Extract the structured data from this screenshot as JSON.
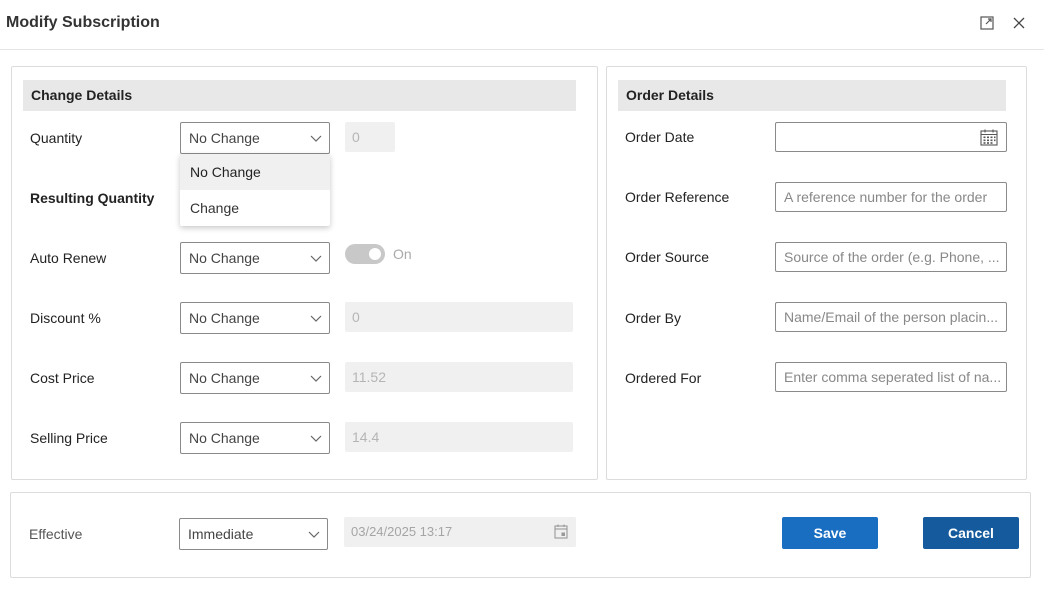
{
  "dialog": {
    "title": "Modify Subscription",
    "expand_icon": "expand-icon",
    "close_icon": "close-icon"
  },
  "change_details": {
    "header": "Change Details",
    "quantity": {
      "label": "Quantity",
      "select": "No Change",
      "value": "0"
    },
    "quantity_dropdown": {
      "options": [
        "No Change",
        "Change"
      ],
      "selected": "No Change"
    },
    "resulting_quantity": {
      "label": "Resulting Quantity"
    },
    "auto_renew": {
      "label": "Auto Renew",
      "select": "No Change",
      "toggle_label": "On",
      "toggle_on": true
    },
    "discount": {
      "label": "Discount %",
      "select": "No Change",
      "value": "0"
    },
    "cost_price": {
      "label": "Cost Price",
      "select": "No Change",
      "value": "11.52"
    },
    "selling_price": {
      "label": "Selling Price",
      "select": "No Change",
      "value": "14.4"
    }
  },
  "order_details": {
    "header": "Order Details",
    "order_date": {
      "label": "Order Date",
      "value": "",
      "icon": "calendar-icon"
    },
    "order_reference": {
      "label": "Order Reference",
      "placeholder": "A reference number for the order"
    },
    "order_source": {
      "label": "Order Source",
      "placeholder": "Source of the order (e.g. Phone, ..."
    },
    "order_by": {
      "label": "Order By",
      "placeholder": "Name/Email of the person placin..."
    },
    "ordered_for": {
      "label": "Ordered For",
      "placeholder": "Enter comma seperated list of na..."
    }
  },
  "footer": {
    "effective_label": "Effective",
    "effective_select": "Immediate",
    "effective_date": "03/24/2025 13:17",
    "save_label": "Save",
    "cancel_label": "Cancel"
  },
  "colors": {
    "save_button": "#1a6ec2",
    "cancel_button": "#145a9c",
    "section_header_bg": "#e8e8e8",
    "disabled_bg": "#f0f0f0"
  }
}
